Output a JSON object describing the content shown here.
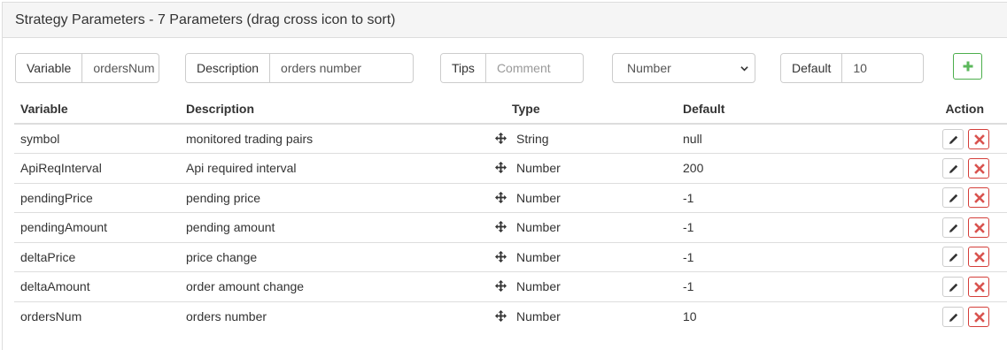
{
  "panel": {
    "title": "Strategy Parameters - 7 Parameters (drag cross icon to sort)"
  },
  "form": {
    "variable_label": "Variable",
    "variable_value": "ordersNum",
    "description_label": "Description",
    "description_value": "orders number",
    "tips_label": "Tips",
    "tips_placeholder": "Comment",
    "type_selected": "Number",
    "default_label": "Default",
    "default_value": "10",
    "add_icon": "plus-icon"
  },
  "table": {
    "headers": {
      "variable": "Variable",
      "description": "Description",
      "type": "Type",
      "default": "Default",
      "action": "Action"
    },
    "rows": [
      {
        "variable": "symbol",
        "description": "monitored trading pairs",
        "type": "String",
        "default": "null"
      },
      {
        "variable": "ApiReqInterval",
        "description": "Api required interval",
        "type": "Number",
        "default": "200"
      },
      {
        "variable": "pendingPrice",
        "description": "pending price",
        "type": "Number",
        "default": "-1"
      },
      {
        "variable": "pendingAmount",
        "description": "pending amount",
        "type": "Number",
        "default": "-1"
      },
      {
        "variable": "deltaPrice",
        "description": "price change",
        "type": "Number",
        "default": "-1"
      },
      {
        "variable": "deltaAmount",
        "description": "order amount change",
        "type": "Number",
        "default": "-1"
      },
      {
        "variable": "ordersNum",
        "description": "orders number",
        "type": "Number",
        "default": "10"
      }
    ]
  },
  "colors": {
    "add_green": "#5cb85c",
    "delete_red": "#d9534f"
  }
}
